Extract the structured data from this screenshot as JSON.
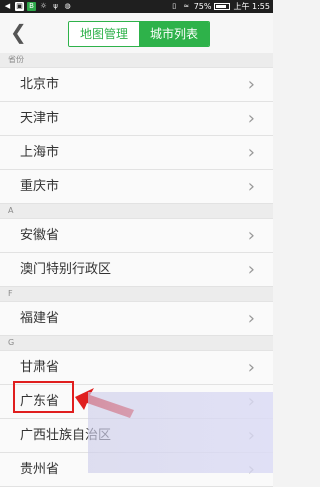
{
  "statusbar": {
    "battery": "75%",
    "time": "上午 1:55"
  },
  "header": {
    "tabs": [
      {
        "label": "地图管理",
        "active": false
      },
      {
        "label": "城市列表",
        "active": true
      }
    ]
  },
  "sections": [
    {
      "title": "省份",
      "items": [
        "北京市",
        "天津市",
        "上海市",
        "重庆市"
      ]
    },
    {
      "title": "A",
      "items": [
        "安徽省",
        "澳门特别行政区"
      ]
    },
    {
      "title": "F",
      "items": [
        "福建省"
      ]
    },
    {
      "title": "G",
      "items": [
        "甘肃省",
        "广东省",
        "广西壮族自治区",
        "贵州省"
      ]
    }
  ],
  "colors": {
    "accent": "#2eb24a",
    "highlight": "#e01e1e"
  }
}
